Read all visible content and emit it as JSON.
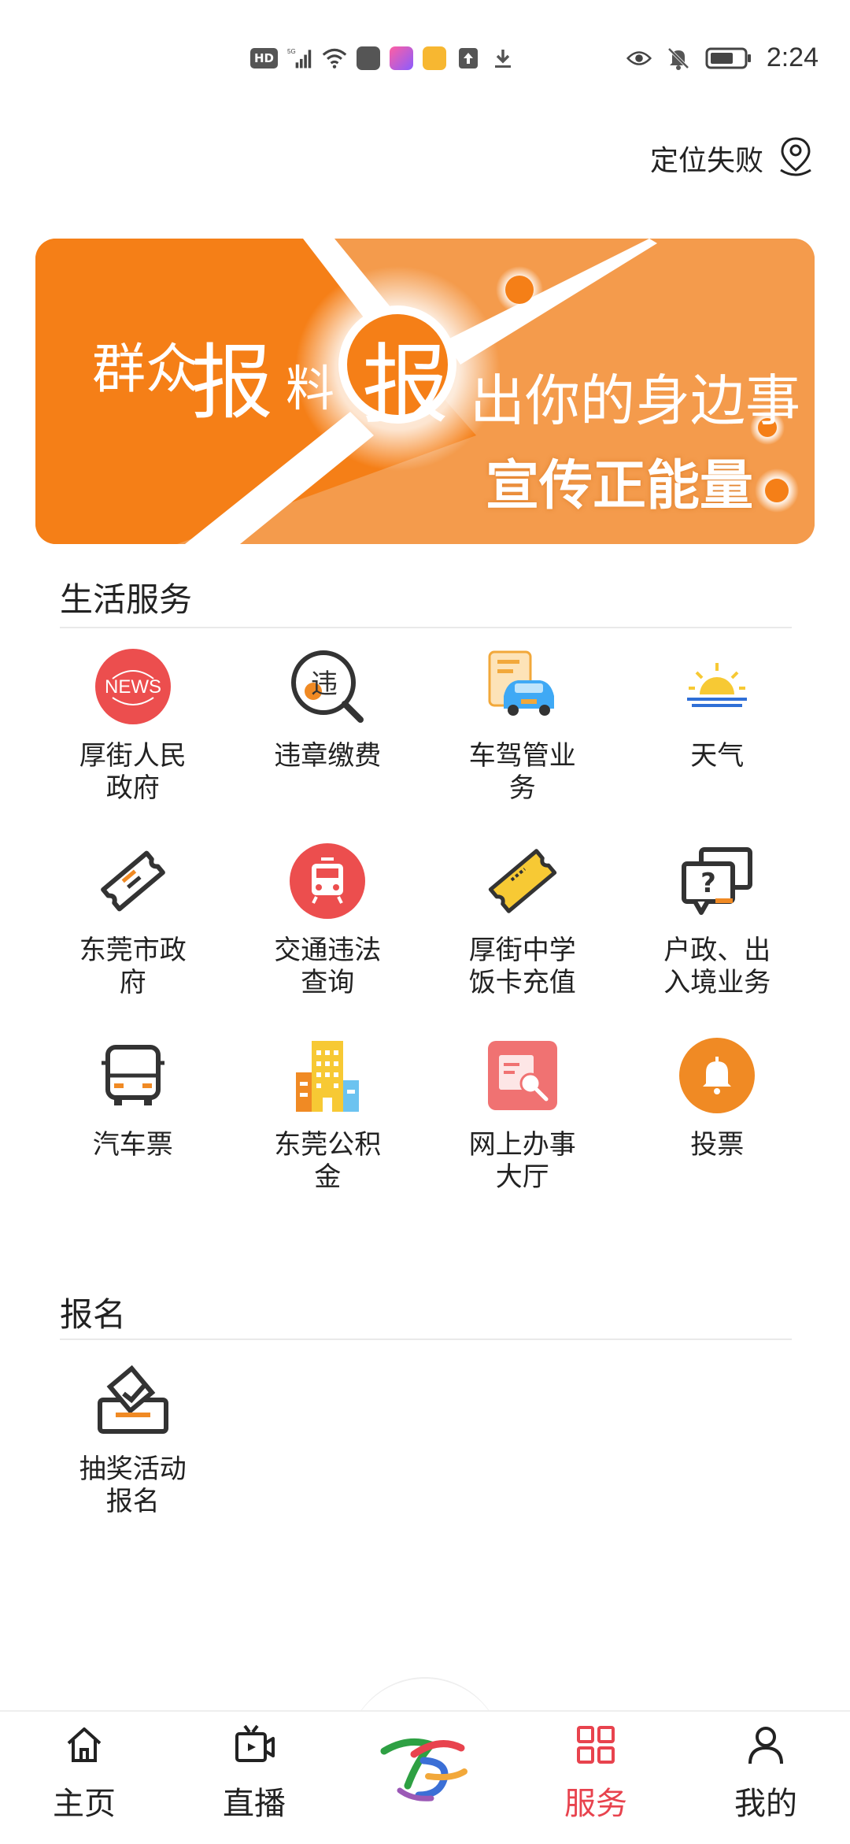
{
  "status_bar": {
    "hd": "HD",
    "network": "5G",
    "time": "2:24",
    "icons": [
      "hd-icon",
      "signal-5g-icon",
      "wifi-icon",
      "huawei-app-icon",
      "info-app-icon",
      "cup-app-icon",
      "upload-icon",
      "download-icon",
      "eye-icon",
      "mute-bell-icon",
      "battery-icon"
    ]
  },
  "location": {
    "text": "定位失败",
    "icon": "location-pin-icon"
  },
  "banner": {
    "left_a": "群众",
    "left_b": "报",
    "left_c": "料",
    "center": "报",
    "right_line1": "出你的身边事",
    "right_line2": "宣传正能量",
    "colors": {
      "primary": "#f57f17",
      "secondary": "#f49b4c"
    }
  },
  "life_services": {
    "title": "生活服务",
    "items": [
      {
        "label": "厚街人民政府",
        "icon": "news-icon"
      },
      {
        "label": "违章缴费",
        "icon": "violation-search-icon"
      },
      {
        "label": "车驾管业务",
        "icon": "car-document-icon"
      },
      {
        "label": "天气",
        "icon": "weather-sunrise-icon"
      },
      {
        "label": "东莞市政府",
        "icon": "ticket-icon"
      },
      {
        "label": "交通违法查询",
        "icon": "train-icon"
      },
      {
        "label": "厚街中学饭卡充值",
        "icon": "card-ticket-icon"
      },
      {
        "label": "户政、出入境业务",
        "icon": "question-chat-icon"
      },
      {
        "label": "汽车票",
        "icon": "bus-icon"
      },
      {
        "label": "东莞公积金",
        "icon": "building-icon"
      },
      {
        "label": "网上办事大厅",
        "icon": "document-search-icon"
      },
      {
        "label": "投票",
        "icon": "bell-icon"
      }
    ]
  },
  "signup": {
    "title": "报名",
    "items": [
      {
        "label": "抽奖活动报名",
        "icon": "ballot-box-icon"
      }
    ]
  },
  "bottom_nav": {
    "items": [
      {
        "label": "主页",
        "icon": "home-icon",
        "active": false
      },
      {
        "label": "直播",
        "icon": "live-tv-icon",
        "active": false
      },
      {
        "label": "",
        "icon": "app-logo-icon",
        "active": false
      },
      {
        "label": "服务",
        "icon": "grid-icon",
        "active": true
      },
      {
        "label": "我的",
        "icon": "user-icon",
        "active": false
      }
    ],
    "active_color": "#e8434e"
  }
}
